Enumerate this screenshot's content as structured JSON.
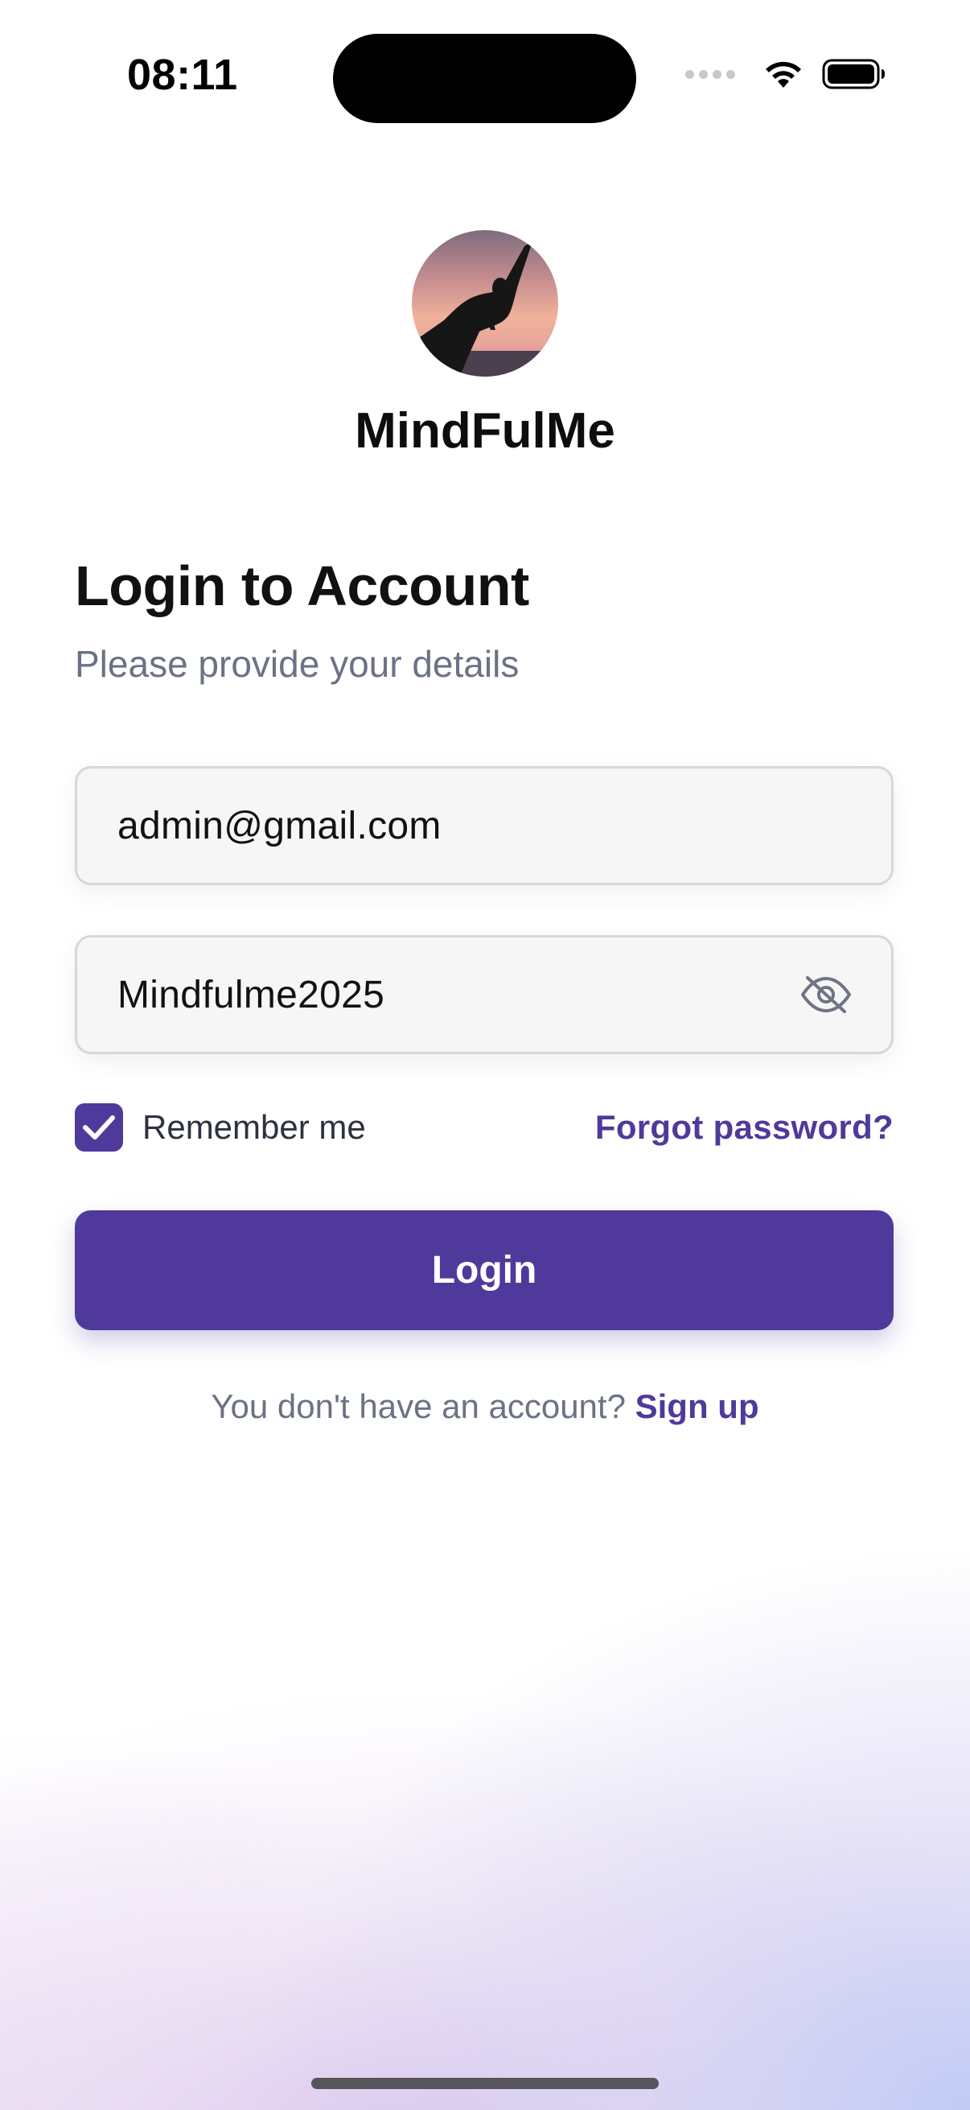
{
  "status_bar": {
    "time": "08:11"
  },
  "brand": {
    "name": "MindFulMe",
    "logo_icon": "yoga-pose-sunset-avatar"
  },
  "login": {
    "title": "Login to Account",
    "subtitle": "Please provide your details",
    "email_value": "admin@gmail.com",
    "password_value": "Mindfulme2025",
    "password_toggle_icon": "eye-off-icon",
    "remember_label": "Remember me",
    "remember_checked": true,
    "forgot_label": "Forgot password?",
    "button_label": "Login",
    "signup_prompt": "You don't have an account?",
    "signup_link": "Sign up"
  },
  "colors": {
    "accent": "#4f3a9b",
    "muted_text": "#6b7285",
    "field_background": "#f6f6f7",
    "field_border": "#d6d7de"
  }
}
